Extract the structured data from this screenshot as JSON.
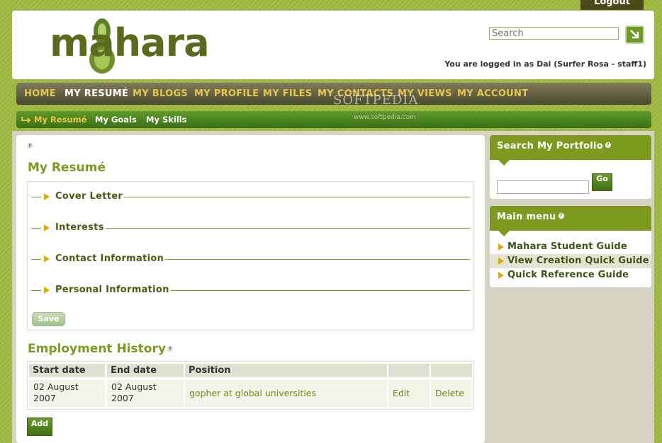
{
  "header": {
    "logout_label": "Logout",
    "logo_text": "mahara",
    "search_placeholder": "Search",
    "logged_in_text": "You are logged in as Dai (Surfer Rosa - staff1)"
  },
  "main_nav": [
    "HOME",
    "MY RESUMÉ",
    "MY BLOGS",
    "MY PROFILE",
    "MY FILES",
    "MY CONTACTS",
    "MY VIEWS",
    "MY ACCOUNT"
  ],
  "sub_nav": [
    "My Resumé",
    "My Goals",
    "My Skills"
  ],
  "watermark": {
    "line1": "SOFTPEDIA",
    "line2": "www.softpedia.com"
  },
  "resume": {
    "title": "My Resumé",
    "sections": [
      "Cover Letter",
      "Interests",
      "Contact Information",
      "Personal Information"
    ],
    "save_label": "Save"
  },
  "employment": {
    "title": "Employment History",
    "columns": [
      "Start date",
      "End date",
      "Position",
      "",
      ""
    ],
    "rows": [
      {
        "start_line1": "02 August",
        "start_line2": "2007",
        "end_line1": "02 August",
        "end_line2": "2007",
        "position": "gopher at global universities",
        "edit": "Edit",
        "delete": "Delete"
      }
    ],
    "add_label": "Add"
  },
  "sidebar": {
    "search_title": "Search My Portfolio",
    "go_label": "Go",
    "menu_title": "Main menu",
    "menu_items": [
      "Mahara Student Guide",
      "View Creation Quick Guide",
      "Quick Reference Guide"
    ]
  },
  "colors": {
    "accent_green": "#7d9a1f",
    "nav_gold": "#e8c64a",
    "nav_dark": "#4c4a2e"
  }
}
